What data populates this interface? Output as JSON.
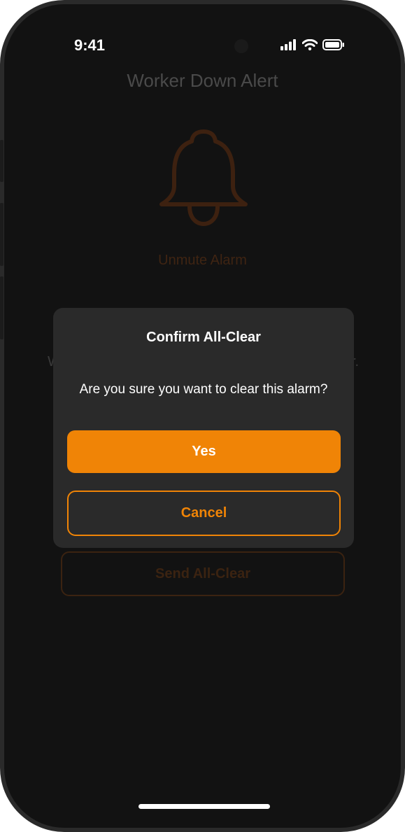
{
  "status_bar": {
    "time": "9:41",
    "icons": [
      "cellular-signal-icon",
      "wifi-icon",
      "battery-icon"
    ]
  },
  "background_screen": {
    "title": "Worker Down Alert",
    "bell_icon": "bell-icon",
    "unmute_label": "Unmute Alarm",
    "partial_text_left": "W",
    "partial_text_right": "r.",
    "send_allclear_label": "Send All-Clear"
  },
  "dialog": {
    "title": "Confirm All-Clear",
    "message": "Are you sure you want to clear this alarm?",
    "yes_label": "Yes",
    "cancel_label": "Cancel"
  },
  "colors": {
    "accent": "#f08406",
    "dialog_bg": "#2a2a2a",
    "screen_bg": "#121212"
  }
}
